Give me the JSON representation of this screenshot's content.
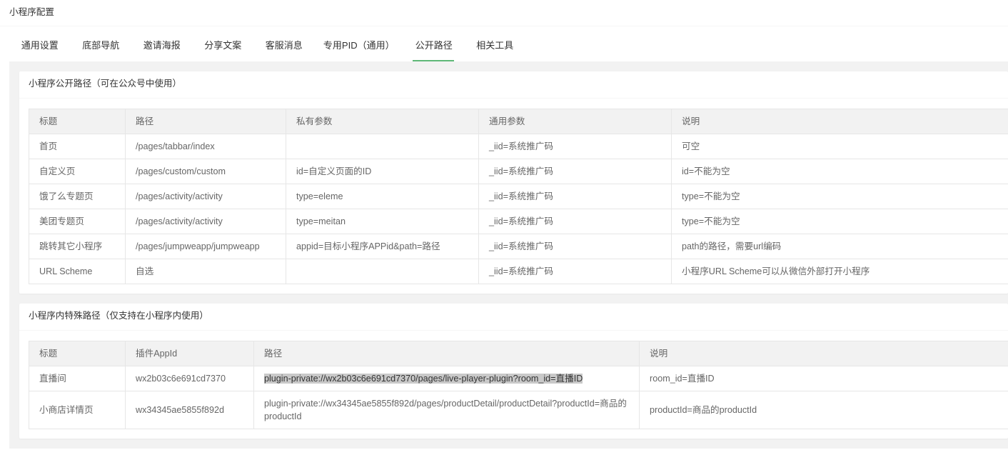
{
  "page": {
    "title": "小程序配置"
  },
  "colors": {
    "accent": "#5FB878",
    "page_background": "#f2f2f2",
    "table_header_background": "#f2f2f2",
    "border": "#e6e6e6",
    "text": "#666666",
    "heading_text": "#333333",
    "selection": "#c9c9c9"
  },
  "tabs": [
    {
      "label": "通用设置",
      "active": false
    },
    {
      "label": "底部导航",
      "active": false
    },
    {
      "label": "邀请海报",
      "active": false
    },
    {
      "label": "分享文案",
      "active": false
    },
    {
      "label": "客服消息",
      "active": false
    },
    {
      "label": "专用PID（通用）",
      "active": false
    },
    {
      "label": "公开路径",
      "active": true
    },
    {
      "label": "相关工具",
      "active": false
    }
  ],
  "public_paths": {
    "title": "小程序公开路径（可在公众号中使用）",
    "columns": [
      "标题",
      "路径",
      "私有参数",
      "通用参数",
      "说明"
    ],
    "rows": [
      {
        "title": "首页",
        "path": "/pages/tabbar/index",
        "private_params": "",
        "common_params": "_iid=系统推广码",
        "description": "可空"
      },
      {
        "title": "自定义页",
        "path": "/pages/custom/custom",
        "private_params": "id=自定义页面的ID",
        "common_params": "_iid=系统推广码",
        "description": "id=不能为空"
      },
      {
        "title": "饿了么专题页",
        "path": "/pages/activity/activity",
        "private_params": "type=eleme",
        "common_params": "_iid=系统推广码",
        "description": "type=不能为空"
      },
      {
        "title": "美团专题页",
        "path": "/pages/activity/activity",
        "private_params": "type=meitan",
        "common_params": "_iid=系统推广码",
        "description": "type=不能为空"
      },
      {
        "title": "跳转其它小程序",
        "path": "/pages/jumpweapp/jumpweapp",
        "private_params": "appid=目标小程序APPid&path=路径",
        "common_params": "_iid=系统推广码",
        "description": "path的路径，需要url编码"
      },
      {
        "title": "URL Scheme",
        "path": "自选",
        "private_params": "",
        "common_params": "_iid=系统推广码",
        "description": "小程序URL Scheme可以从微信外部打开小程序"
      }
    ]
  },
  "special_paths": {
    "title": "小程序内特殊路径（仅支持在小程序内使用）",
    "columns": [
      "标题",
      "插件AppId",
      "路径",
      "说明"
    ],
    "rows": [
      {
        "title": "直播间",
        "plugin_appid": "wx2b03c6e691cd7370",
        "path": "plugin-private://wx2b03c6e691cd7370/pages/live-player-plugin?room_id=直播ID",
        "description": "room_id=直播ID"
      },
      {
        "title": "小商店详情页",
        "plugin_appid": "wx34345ae5855f892d",
        "path": "plugin-private://wx34345ae5855f892d/pages/productDetail/productDetail?productId=商品的productId",
        "description": "productId=商品的productId"
      }
    ]
  }
}
